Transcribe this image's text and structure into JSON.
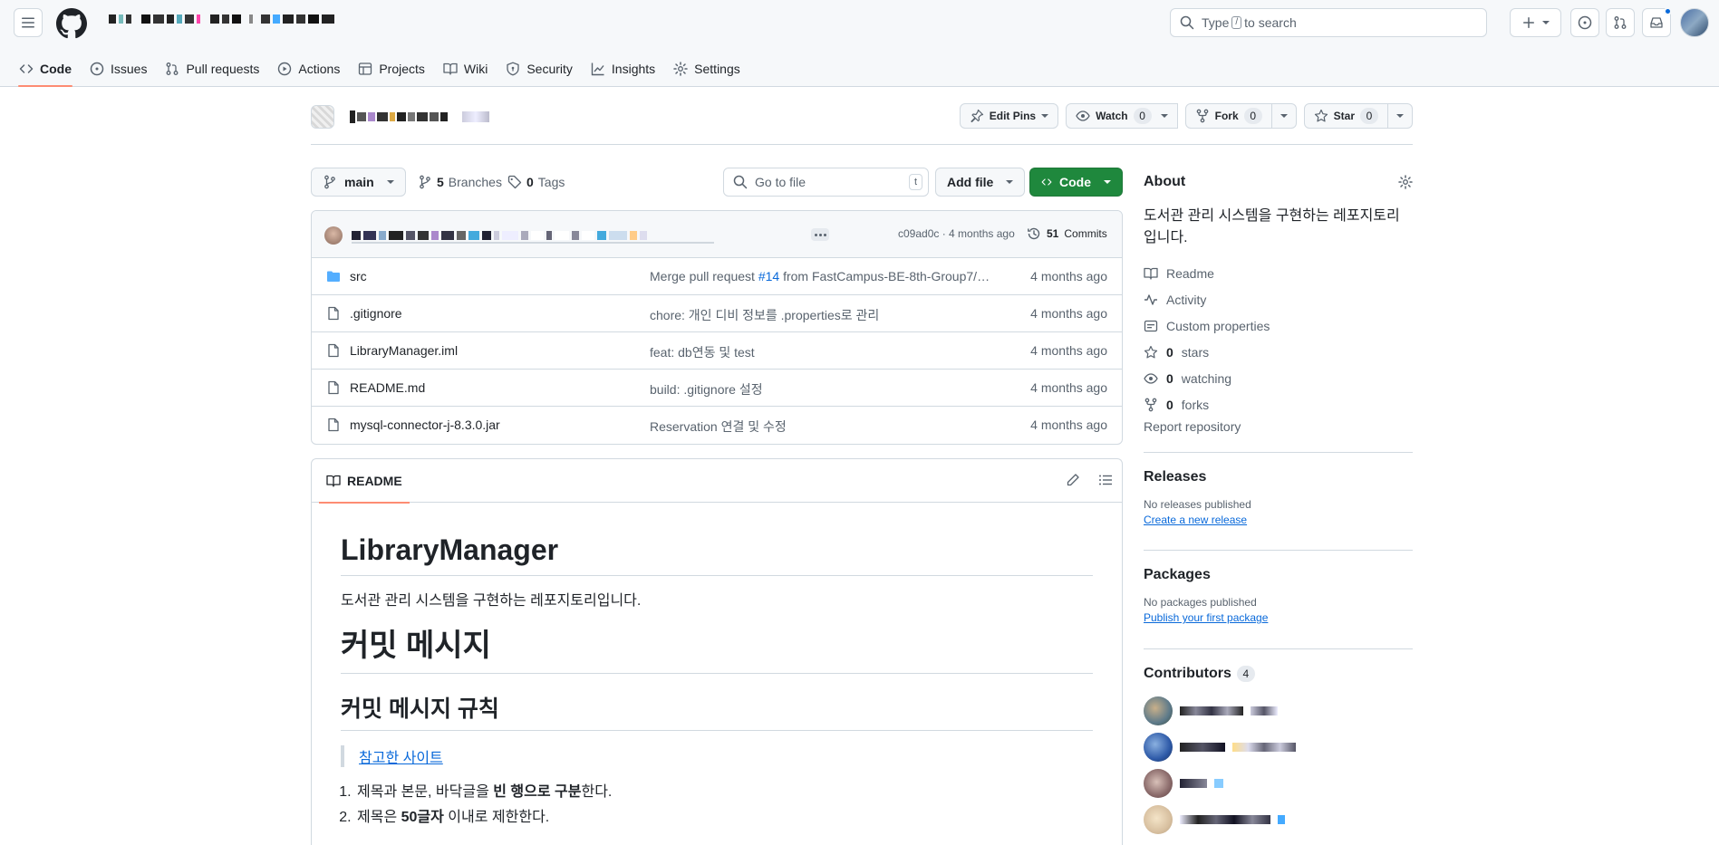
{
  "header": {
    "search_placeholder_prefix": "Type",
    "search_kbd": "/",
    "search_placeholder_suffix": "to search"
  },
  "repo_nav": [
    {
      "label": "Code",
      "icon": "code-icon",
      "selected": true
    },
    {
      "label": "Issues",
      "icon": "issue-icon"
    },
    {
      "label": "Pull requests",
      "icon": "pull-request-icon"
    },
    {
      "label": "Actions",
      "icon": "play-icon"
    },
    {
      "label": "Projects",
      "icon": "table-icon"
    },
    {
      "label": "Wiki",
      "icon": "book-icon"
    },
    {
      "label": "Security",
      "icon": "shield-icon"
    },
    {
      "label": "Insights",
      "icon": "graph-icon"
    },
    {
      "label": "Settings",
      "icon": "gear-icon"
    }
  ],
  "repo_actions": {
    "edit_pins": "Edit Pins",
    "watch": "Watch",
    "watch_count": "0",
    "fork": "Fork",
    "fork_count": "0",
    "star": "Star",
    "star_count": "0"
  },
  "toolbar": {
    "branch": "main",
    "branches_count": "5",
    "branches_label": "Branches",
    "tags_count": "0",
    "tags_label": "Tags",
    "goto_placeholder": "Go to file",
    "goto_kbd": "t",
    "add_file": "Add file",
    "code": "Code"
  },
  "latest_commit": {
    "hash": "c09ad0c · 4 months ago",
    "commits_count": "51",
    "commits_label": "Commits"
  },
  "files": [
    {
      "name": "src",
      "type": "folder",
      "msg_pre": "Merge pull request ",
      "msg_link": "#14",
      "msg_post": " from FastCampus-BE-8th-Group7/o...",
      "date": "4 months ago"
    },
    {
      "name": ".gitignore",
      "type": "file",
      "msg_pre": "chore: 개인 디비 정보를 .properties로 관리",
      "msg_link": "",
      "msg_post": "",
      "date": "4 months ago"
    },
    {
      "name": "LibraryManager.iml",
      "type": "file",
      "msg_pre": "feat: db연동 및 test",
      "msg_link": "",
      "msg_post": "",
      "date": "4 months ago"
    },
    {
      "name": "README.md",
      "type": "file",
      "msg_pre": "build: .gitignore 설정",
      "msg_link": "",
      "msg_post": "",
      "date": "4 months ago"
    },
    {
      "name": "mysql-connector-j-8.3.0.jar",
      "type": "file",
      "msg_pre": "Reservation 연결 및 수정",
      "msg_link": "",
      "msg_post": "",
      "date": "4 months ago"
    }
  ],
  "readme": {
    "tab": "README",
    "title": "LibraryManager",
    "intro": "도서관 관리 시스템을 구현하는 레포지토리입니다.",
    "h1_commit": "커밋 메시지",
    "h2_rules": "커밋 메시지 규칙",
    "quote_link": "참고한 사이트",
    "list": [
      {
        "a": "제목과 본문, 바닥글을 ",
        "b": "빈 행으로 구분",
        "c": "한다."
      },
      {
        "a": "제목은 ",
        "b": "50글자",
        "c": " 이내로 제한한다."
      }
    ]
  },
  "about": {
    "title": "About",
    "description": "도서관 관리 시스템을 구현하는 레포지토리입니다.",
    "readme": "Readme",
    "activity": "Activity",
    "custom_properties": "Custom properties",
    "stars_count": "0",
    "stars_label": "stars",
    "watching_count": "0",
    "watching_label": "watching",
    "forks_count": "0",
    "forks_label": "forks",
    "report": "Report repository"
  },
  "releases": {
    "title": "Releases",
    "note": "No releases published",
    "link": "Create a new release"
  },
  "packages": {
    "title": "Packages",
    "note": "No packages published",
    "link": "Publish your first package"
  },
  "contributors": {
    "title": "Contributors",
    "count": "4"
  },
  "colors": {
    "accent_green": "#1f883d",
    "link_blue": "#0969da",
    "tab_underline": "#fd8c73"
  }
}
